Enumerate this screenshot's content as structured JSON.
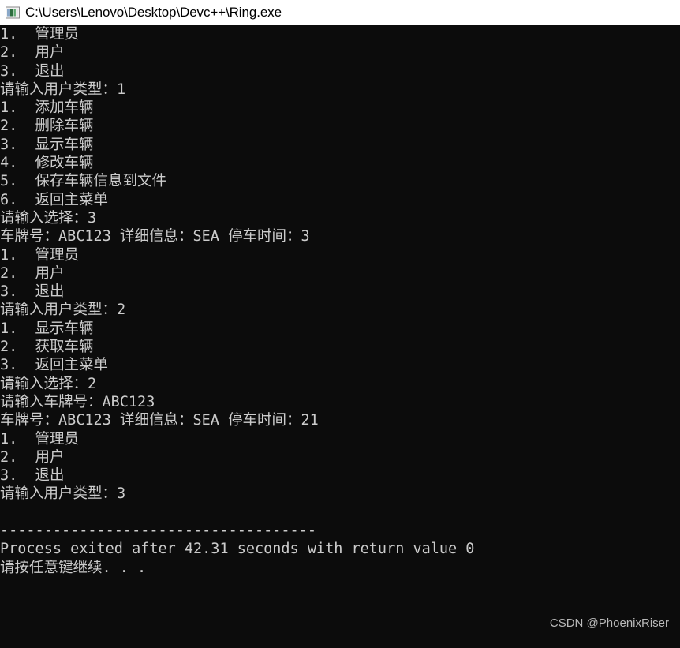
{
  "window": {
    "title": "C:\\Users\\Lenovo\\Desktop\\Devc++\\Ring.exe",
    "icon": "console-window-icon",
    "background_color": "#0c0c0c",
    "titlebar_background_color": "#ffffff",
    "titlebar_text_color": "#000000",
    "console_text_color": "#cccccc"
  },
  "console": {
    "lines": [
      "1.  管理员",
      "2.  用户",
      "3.  退出",
      "请输入用户类型：1",
      "1.  添加车辆",
      "2.  删除车辆",
      "3.  显示车辆",
      "4.  修改车辆",
      "5.  保存车辆信息到文件",
      "6.  返回主菜单",
      "请输入选择：3",
      "车牌号：ABC123 详细信息：SEA 停车时间：3",
      "1.  管理员",
      "2.  用户",
      "3.  退出",
      "请输入用户类型：2",
      "1.  显示车辆",
      "2.  获取车辆",
      "3.  返回主菜单",
      "请输入选择：2",
      "请输入车牌号：ABC123",
      "车牌号：ABC123 详细信息：SEA 停车时间：21",
      "1.  管理员",
      "2.  用户",
      "3.  退出",
      "请输入用户类型：3",
      "",
      "------------------------------------",
      "Process exited after 42.31 seconds with return value 0",
      "请按任意键继续. . ."
    ]
  },
  "watermark": {
    "text": "CSDN @PhoenixRiser"
  }
}
